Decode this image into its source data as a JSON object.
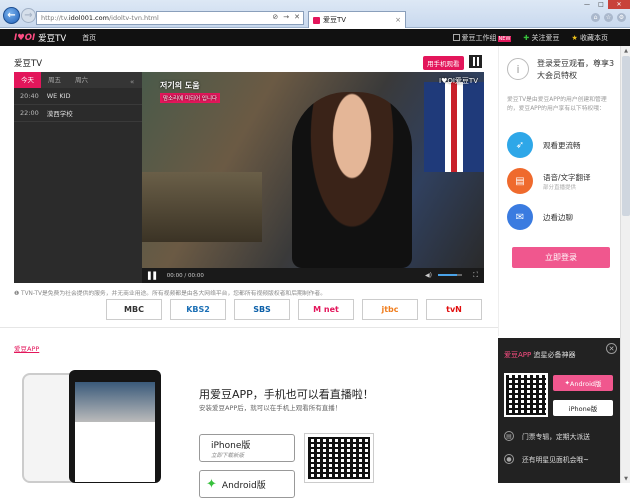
{
  "browser": {
    "url_prefix": "http://tv.",
    "url_domain": "idol001.com",
    "url_path": "/idoltv-tvn.html",
    "tab_title": "爱豆TV",
    "addr_icons": [
      "⊘",
      "→",
      "✕"
    ],
    "back_glyph": "←",
    "fwd_glyph": "→",
    "tab_close": "×",
    "win_minimize": "—",
    "win_maximize": "□",
    "win_close": "✕",
    "tool_home": "⌂",
    "tool_star": "☆",
    "tool_settings": "⚙"
  },
  "header": {
    "logo_mark": "I♥OI",
    "logo_text": "爱豆TV",
    "home": "首页",
    "workbench": "爱豆工作组",
    "workbench_badge": "NEW",
    "follow": "关注爱豆",
    "favorite": "收藏本页"
  },
  "main": {
    "title": "爱豆TV",
    "mobile_watch": "用手机观看",
    "disclaimer": "TVN-TV是免费为社会提供的服务，并无商业用途。所有视频都是由各大网络平台，您都所有视频版权者和后期制作者。",
    "app_tag": "爱豆APP",
    "app_title": "用爱豆APP，手机也可以看直播啦！",
    "app_sub": "安装爱豆APP后，就可以在手机上观看所有直播！",
    "iphone_label": "iPhone版",
    "iphone_sub": "立即下载新版",
    "android_label": "Android版"
  },
  "player": {
    "days": [
      "今天",
      "周五",
      "周六"
    ],
    "collapse": "«",
    "programs": [
      {
        "time": "20:40",
        "name": "WE KID"
      },
      {
        "time": "22:00",
        "name": "漠西学校"
      }
    ],
    "video_tag": "저기의 도움",
    "video_tag_sub": "맘소리에 미되어 입니다",
    "video_logo": "I♥OI爱豆TV",
    "play_glyph": "▌▌",
    "time": "00:00 / 00:00",
    "vol_glyph": "◀)",
    "full_glyph": "⛶",
    "volume_level": 0.8
  },
  "channels": [
    "MBC",
    "KBS2",
    "SBS",
    "M net",
    "jtbc",
    "tvN"
  ],
  "channel_colors": [
    "#333333",
    "#1b6fb5",
    "#0b5fa8",
    "#e3165b",
    "#f07e1f",
    "#e10d0d"
  ],
  "sidebar": {
    "info_glyph": "i",
    "title": "登录爱豆观看，尊享3大会员特权",
    "desc": "爱豆TV是由爱豆APP的用户创建和管理的，爱豆APP的用户享有以下特权哦：",
    "features": [
      {
        "label": "观看更流畅",
        "sub": "",
        "color": "#2ea7e8",
        "glyph": "➶"
      },
      {
        "label": "语音/文字翻译",
        "sub": "部分直播提供",
        "color": "#ef6a2d",
        "glyph": "▤"
      },
      {
        "label": "边看边聊",
        "sub": "",
        "color": "#3a7be0",
        "glyph": "✉"
      }
    ],
    "login": "立即登录"
  },
  "promo": {
    "title_pink": "爱豆APP",
    "title_rest": " 追星必备神器",
    "close": "✕",
    "android": "Android版",
    "iphone": "iPhone版",
    "lines": [
      "门票专辑，定期大派送",
      "还有明星见面机会哦~"
    ]
  }
}
